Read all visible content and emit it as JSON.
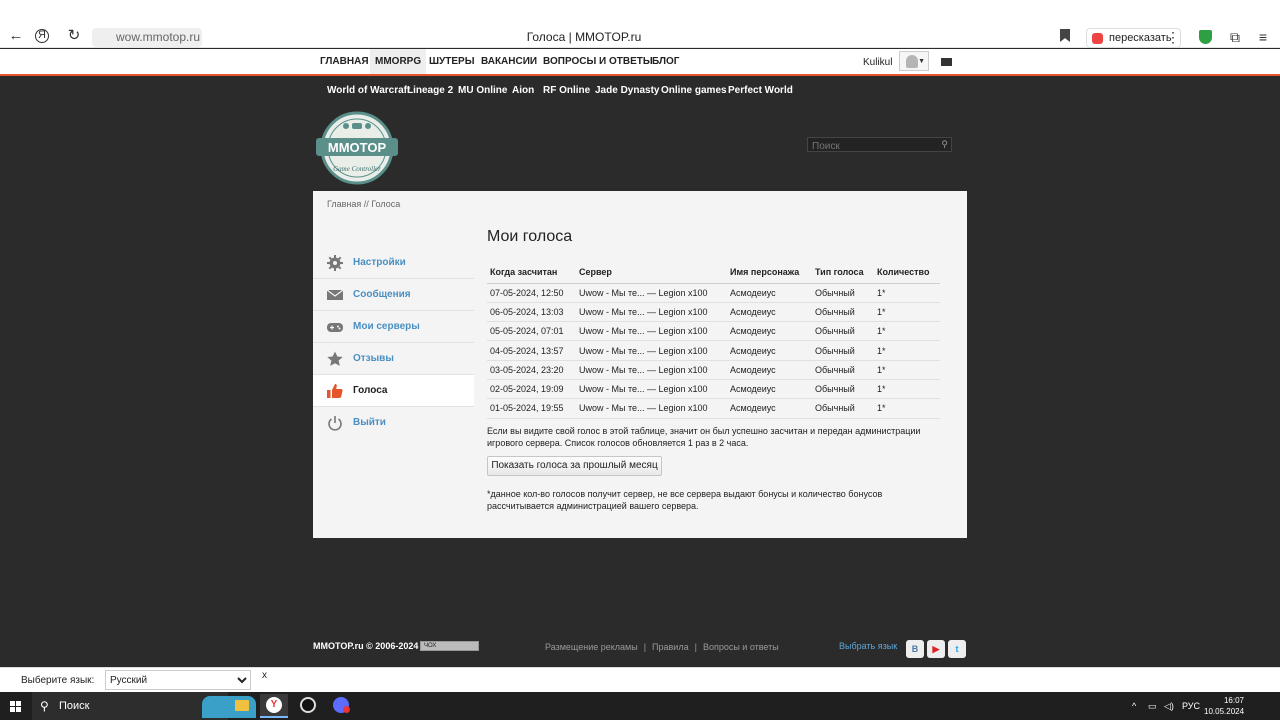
{
  "browser": {
    "tab_title": "Голоса | MMOTOP.ru",
    "url": "wow.mmotop.ru",
    "retell_label": "пересказать"
  },
  "topnav": {
    "items": [
      "ГЛАВНАЯ",
      "MMORPG",
      "ШУТЕРЫ",
      "ВАКАНСИИ",
      "ВОПРОСЫ И ОТВЕТЫ",
      "БЛОГ"
    ],
    "active": "MMORPG",
    "username": "Kulikul"
  },
  "gamenav": [
    "World of Warcraft",
    "Lineage 2",
    "MU Online",
    "Aion",
    "RF Online",
    "Jade Dynasty",
    "Online games",
    "Perfect World"
  ],
  "logo": {
    "text": "MMOTOP",
    "subtext": "Game Controller"
  },
  "search": {
    "placeholder": "Поиск"
  },
  "breadcrumb": {
    "home": "Главная",
    "sep": " // ",
    "current": "Голоса"
  },
  "sidebar": {
    "items": [
      {
        "label": "Настройки",
        "icon": "gear-icon"
      },
      {
        "label": "Сообщения",
        "icon": "envelope-icon"
      },
      {
        "label": "Мои серверы",
        "icon": "gamepad-icon"
      },
      {
        "label": "Отзывы",
        "icon": "star-icon"
      },
      {
        "label": "Голоса",
        "icon": "thumbs-up-icon",
        "active": true
      },
      {
        "label": "Выйти",
        "icon": "power-icon"
      }
    ]
  },
  "main": {
    "title": "Мои голоса",
    "columns": [
      "Когда засчитан",
      "Сервер",
      "Имя персонажа",
      "Тип голоса",
      "Количество"
    ],
    "rows": [
      [
        "07-05-2024, 12:50",
        "Uwow - Мы те... — Legion x100",
        "Асмодеиус",
        "Обычный",
        "1*"
      ],
      [
        "06-05-2024, 13:03",
        "Uwow - Мы те... — Legion x100",
        "Асмодеиус",
        "Обычный",
        "1*"
      ],
      [
        "05-05-2024, 07:01",
        "Uwow - Мы те... — Legion x100",
        "Асмодеиус",
        "Обычный",
        "1*"
      ],
      [
        "04-05-2024, 13:57",
        "Uwow - Мы те... — Legion x100",
        "Асмодеиус",
        "Обычный",
        "1*"
      ],
      [
        "03-05-2024, 23:20",
        "Uwow - Мы те... — Legion x100",
        "Асмодеиус",
        "Обычный",
        "1*"
      ],
      [
        "02-05-2024, 19:09",
        "Uwow - Мы те... — Legion x100",
        "Асмодеиус",
        "Обычный",
        "1*"
      ],
      [
        "01-05-2024, 19:55",
        "Uwow - Мы те... — Legion x100",
        "Асмодеиус",
        "Обычный",
        "1*"
      ]
    ],
    "note": "Если вы видите свой голос в этой таблице, значит он был успешно засчитан и передан администрации игрового сервера. Список голосов обновляется 1 раз в 2 часа.",
    "button": "Показать голоса за прошлый месяц",
    "footnote": "*данное кол-во голосов получит сервер, не все сервера выдают бонусы и количество бонусов рассчитывается администрацией вашего сервера."
  },
  "footer": {
    "copyright": "MMOTOP.ru © 2006-2024",
    "counter": "ЧОХ",
    "links": [
      "Размещение рекламы",
      "Правила",
      "Вопросы и ответы"
    ],
    "lang_link": "Выбрать язык",
    "social": [
      "В",
      "▶",
      "t"
    ]
  },
  "translate": {
    "label": "Выберите язык:",
    "selected": "Русский",
    "close": "x"
  },
  "taskbar": {
    "search": "Поиск",
    "lang": "РУС",
    "time": "16:07",
    "date": "10.05.2024"
  },
  "colors": {
    "accent": "#e4552c",
    "link": "#4a8fc1",
    "panel": "#f4f4f4",
    "bg": "#2b2b2b"
  }
}
